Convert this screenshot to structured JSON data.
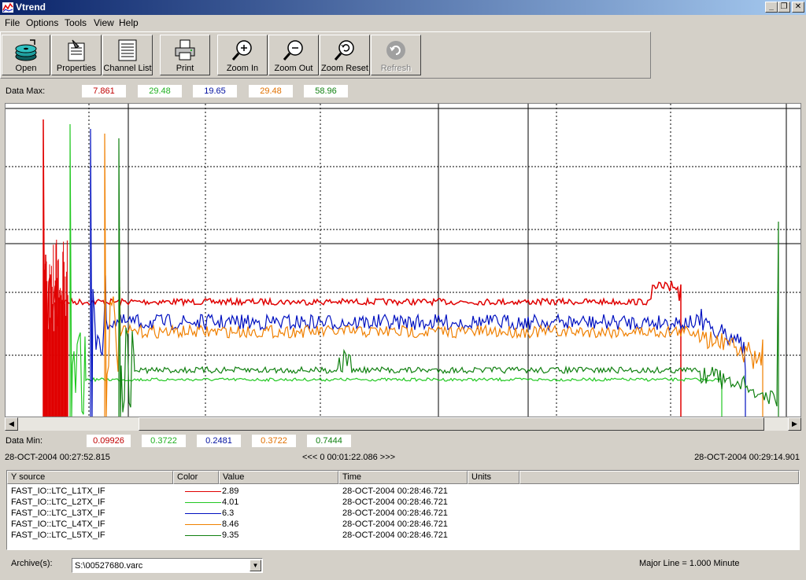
{
  "window": {
    "title": "Vtrend",
    "min": "_",
    "restore": "❐",
    "close": "✕"
  },
  "menu": [
    "File",
    "Options",
    "Tools",
    "View",
    "Help"
  ],
  "toolbar": {
    "open": "Open",
    "properties": "Properties",
    "channel_list": "Channel List",
    "print": "Print",
    "zoom_in": "Zoom In",
    "zoom_out": "Zoom Out",
    "zoom_reset": "Zoom Reset",
    "refresh": "Refresh"
  },
  "data_max": {
    "label": "Data Max:",
    "values": [
      "7.861",
      "29.48",
      "19.65",
      "29.48",
      "58.96"
    ]
  },
  "data_min": {
    "label": "Data Min:",
    "values": [
      "0.09926",
      "0.3722",
      "0.2481",
      "0.3722",
      "0.7444"
    ]
  },
  "colors": [
    "#e00000",
    "#22c822",
    "#0010c0",
    "#f08000",
    "#108010"
  ],
  "time": {
    "start": "28-OCT-2004 00:27:52.815",
    "span": "<<< 0 00:01:22.086 >>>",
    "end": "28-OCT-2004 00:29:14.901"
  },
  "table": {
    "headers": [
      "Y source",
      "Color",
      "Value",
      "Time",
      "Units"
    ],
    "rows": [
      {
        "source": "FAST_IO::LTC_L1TX_IF",
        "value": "2.89",
        "time": "28-OCT-2004 00:28:46.721"
      },
      {
        "source": "FAST_IO::LTC_L2TX_IF",
        "value": "4.01",
        "time": "28-OCT-2004 00:28:46.721"
      },
      {
        "source": "FAST_IO::LTC_L3TX_IF",
        "value": "6.3",
        "time": "28-OCT-2004 00:28:46.721"
      },
      {
        "source": "FAST_IO::LTC_L4TX_IF",
        "value": "8.46",
        "time": "28-OCT-2004 00:28:46.721"
      },
      {
        "source": "FAST_IO::LTC_L5TX_IF",
        "value": "9.35",
        "time": "28-OCT-2004 00:28:46.721"
      }
    ]
  },
  "archive": {
    "label": "Archive(s):",
    "value": "S:\\00527680.varc"
  },
  "major_line": "Major Line = 1.000 Minute",
  "icons": [
    "disk-stack-icon",
    "properties-icon",
    "channel-list-icon",
    "printer-icon",
    "zoom-in-icon",
    "zoom-out-icon",
    "zoom-reset-icon",
    "refresh-icon"
  ]
}
